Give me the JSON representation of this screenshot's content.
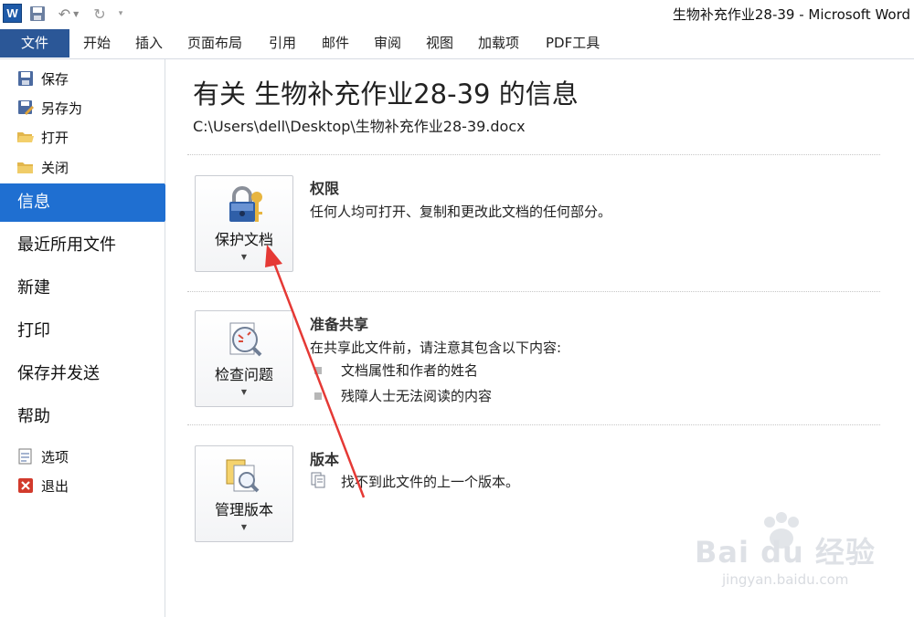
{
  "titlebar": {
    "app_title": "生物补充作业28-39 - Microsoft Word",
    "logo_letter": "W"
  },
  "ribbon": {
    "tabs": [
      "文件",
      "开始",
      "插入",
      "页面布局",
      "引用",
      "邮件",
      "审阅",
      "视图",
      "加载项",
      "PDF工具"
    ]
  },
  "leftnav": {
    "commands": [
      {
        "label": "保存",
        "icon": "save-icon"
      },
      {
        "label": "另存为",
        "icon": "save-as-icon"
      },
      {
        "label": "打开",
        "icon": "open-folder-icon"
      },
      {
        "label": "关闭",
        "icon": "close-folder-icon"
      }
    ],
    "tabs": [
      "信息",
      "最近所用文件",
      "新建",
      "打印",
      "保存并发送",
      "帮助"
    ],
    "selected_tab": "信息",
    "bottom_commands": [
      {
        "label": "选项",
        "icon": "options-icon"
      },
      {
        "label": "退出",
        "icon": "exit-icon"
      }
    ]
  },
  "main": {
    "title": "有关 生物补充作业28-39 的信息",
    "path": "C:\\Users\\dell\\Desktop\\生物补充作业28-39.docx",
    "sections": {
      "permissions": {
        "button_label": "保护文档",
        "heading": "权限",
        "text": "任何人均可打开、复制和更改此文档的任何部分。"
      },
      "prepare": {
        "button_label": "检查问题",
        "heading": "准备共享",
        "text": "在共享此文件前，请注意其包含以下内容:",
        "bullets": [
          "文档属性和作者的姓名",
          "残障人士无法阅读的内容"
        ]
      },
      "versions": {
        "button_label": "管理版本",
        "heading": "版本",
        "text": "找不到此文件的上一个版本。"
      }
    },
    "dropdown_glyph": "▼"
  },
  "watermark": {
    "brand": "Bai du 经验",
    "url": "jingyan.baidu.com"
  },
  "colors": {
    "file_tab": "#2b5797",
    "selected_nav": "#1f6fd1",
    "annotation_arrow": "#e53935"
  }
}
